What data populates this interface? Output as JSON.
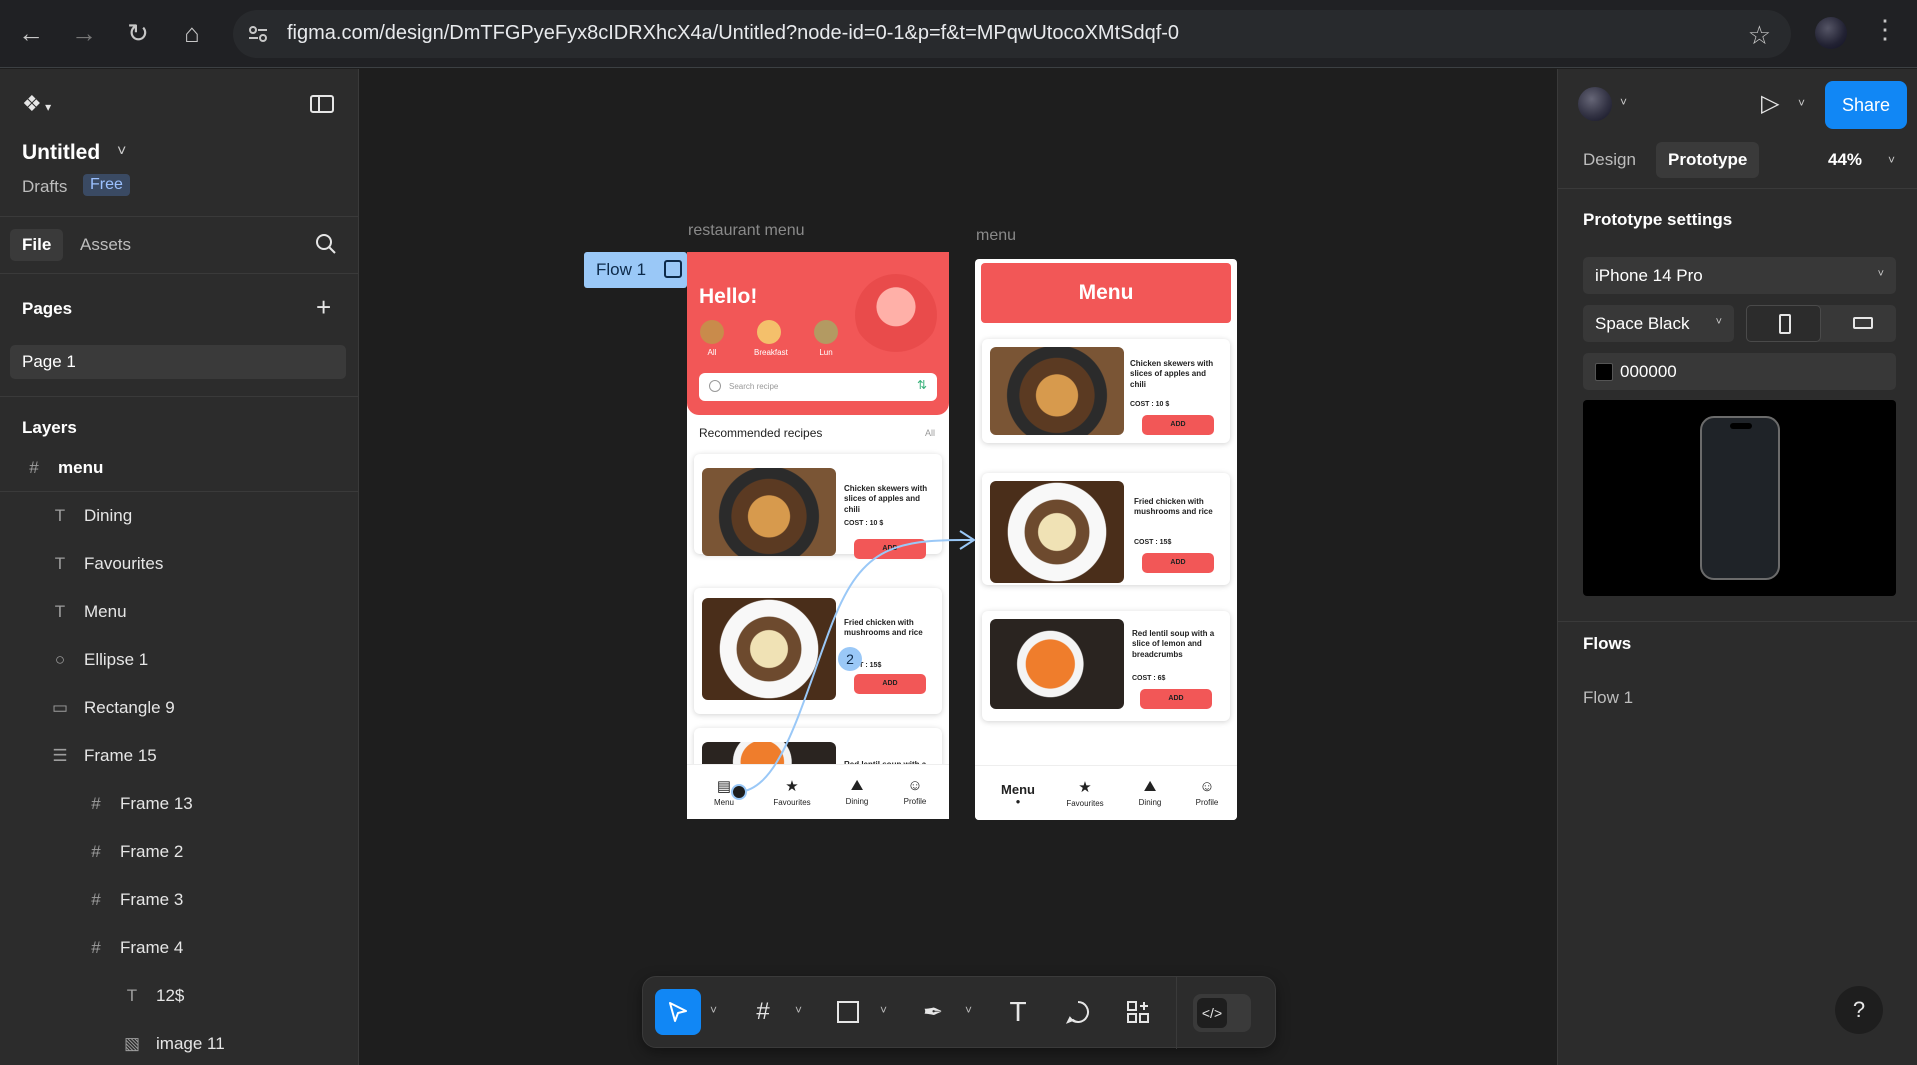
{
  "browser": {
    "url": "figma.com/design/DmTFGPyeFyx8cIDRXhcX4a/Untitled?node-id=0-1&p=f&t=MPqwUtocoXMtSdqf-0"
  },
  "left_panel": {
    "file_title": "Untitled",
    "location": "Drafts",
    "plan_badge": "Free",
    "tabs": [
      "File",
      "Assets"
    ],
    "pages_heading": "Pages",
    "pages": [
      "Page 1"
    ],
    "layers_heading": "Layers",
    "layers": [
      {
        "name": "menu",
        "icon": "frame-icon"
      },
      {
        "name": "Dining",
        "icon": "text-icon"
      },
      {
        "name": "Favourites",
        "icon": "text-icon"
      },
      {
        "name": "Menu",
        "icon": "text-icon"
      },
      {
        "name": "Ellipse 1",
        "icon": "ellipse-icon"
      },
      {
        "name": "Rectangle 9",
        "icon": "rectangle-icon"
      },
      {
        "name": "Frame 15",
        "icon": "autolayout-icon"
      },
      {
        "name": "Frame 13",
        "icon": "frame-icon"
      },
      {
        "name": "Frame 2",
        "icon": "frame-icon"
      },
      {
        "name": "Frame 3",
        "icon": "frame-icon"
      },
      {
        "name": "Frame 4",
        "icon": "frame-icon"
      },
      {
        "name": "12$",
        "icon": "text-icon"
      },
      {
        "name": "image 11",
        "icon": "image-icon"
      }
    ]
  },
  "canvas": {
    "flow_badge": "Flow 1",
    "flow_step": "2",
    "home_frame": {
      "label": "restaurant menu",
      "greeting": "Hello!",
      "categories": [
        "All",
        "Breakfast",
        "Lun"
      ],
      "search_placeholder": "Search recipe",
      "section_title": "Recommended recipes",
      "section_link": "All",
      "cards": [
        {
          "title": "Chicken skewers with slices of apples and chili",
          "cost": "COST : 10 $",
          "button": "ADD"
        },
        {
          "title": "Fried chicken with mushrooms and rice",
          "cost": "COST : 15$",
          "button": "ADD"
        },
        {
          "title": "Red lentil soup with a",
          "cost": "",
          "button": ""
        }
      ],
      "nav": [
        "Menu",
        "Favourites",
        "Dining",
        "Profile"
      ]
    },
    "menu_frame": {
      "label": "menu",
      "header": "Menu",
      "cards": [
        {
          "title": "Chicken skewers with slices of apples and chili",
          "cost": "COST : 10 $",
          "button": "ADD"
        },
        {
          "title": "Fried chicken with mushrooms and rice",
          "cost": "COST : 15$",
          "button": "ADD"
        },
        {
          "title": "Red lentil soup with a slice of lemon and breadcrumbs",
          "cost": "COST : 6$",
          "button": "ADD"
        }
      ],
      "nav": [
        "Menu",
        "Favourites",
        "Dining",
        "Profile"
      ]
    }
  },
  "right_panel": {
    "share_label": "Share",
    "tabs": [
      "Design",
      "Prototype"
    ],
    "active_tab": "Prototype",
    "zoom": "44%",
    "settings_heading": "Prototype settings",
    "device": "iPhone 14 Pro",
    "device_color": "Space Black",
    "background_hex": "000000",
    "flows_heading": "Flows",
    "flows": [
      "Flow 1"
    ],
    "help_label": "?"
  },
  "colors": {
    "accent": "#1187f5",
    "brand_red": "#f25757",
    "flow_blue": "#9ac8f7",
    "panel_bg": "#2c2c2c",
    "canvas_bg": "#1e1e1e"
  }
}
